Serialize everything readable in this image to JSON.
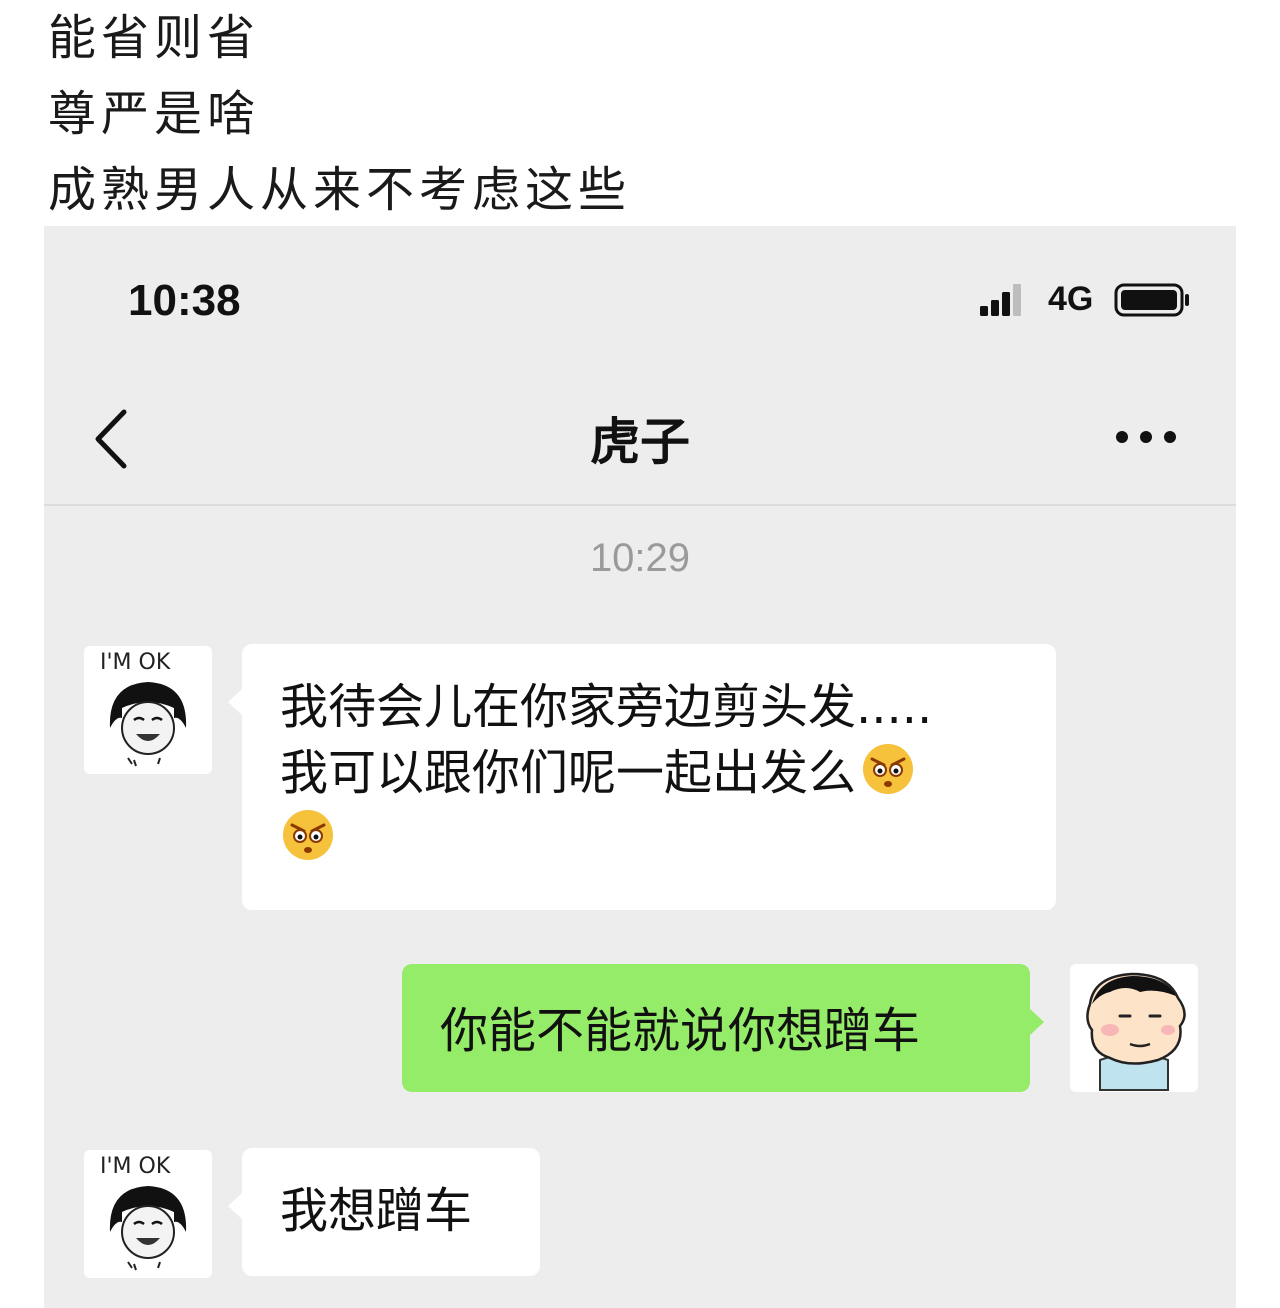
{
  "caption": {
    "lines": [
      "能省则省",
      "尊严是啥",
      "成熟男人从来不考虑这些"
    ]
  },
  "status_bar": {
    "time": "10:38",
    "network": "4G",
    "icons": [
      "signal-icon",
      "battery-icon"
    ]
  },
  "nav": {
    "title": "虎子",
    "back_icon": "chevron-left-icon",
    "more_icon": "more-dots-icon"
  },
  "chat": {
    "timestamp": "10:29",
    "messages": [
      {
        "side": "in",
        "avatar_text": "I'M OK",
        "lines": [
          "我待会儿在你家旁边剪头发.....",
          "我可以跟你们呢一起出发么"
        ],
        "emoji": "angry-face-emoji"
      },
      {
        "side": "out",
        "avatar": "cartoon-boy-avatar",
        "lines": [
          "你能不能就说你想蹭车"
        ]
      },
      {
        "side": "in",
        "avatar_text": "I'M OK",
        "lines": [
          "我想蹭车"
        ]
      }
    ]
  },
  "colors": {
    "chat_background": "#ededed",
    "outgoing_bubble": "#95ec69",
    "incoming_bubble": "#ffffff",
    "timestamp_text": "#9a9a9a"
  }
}
